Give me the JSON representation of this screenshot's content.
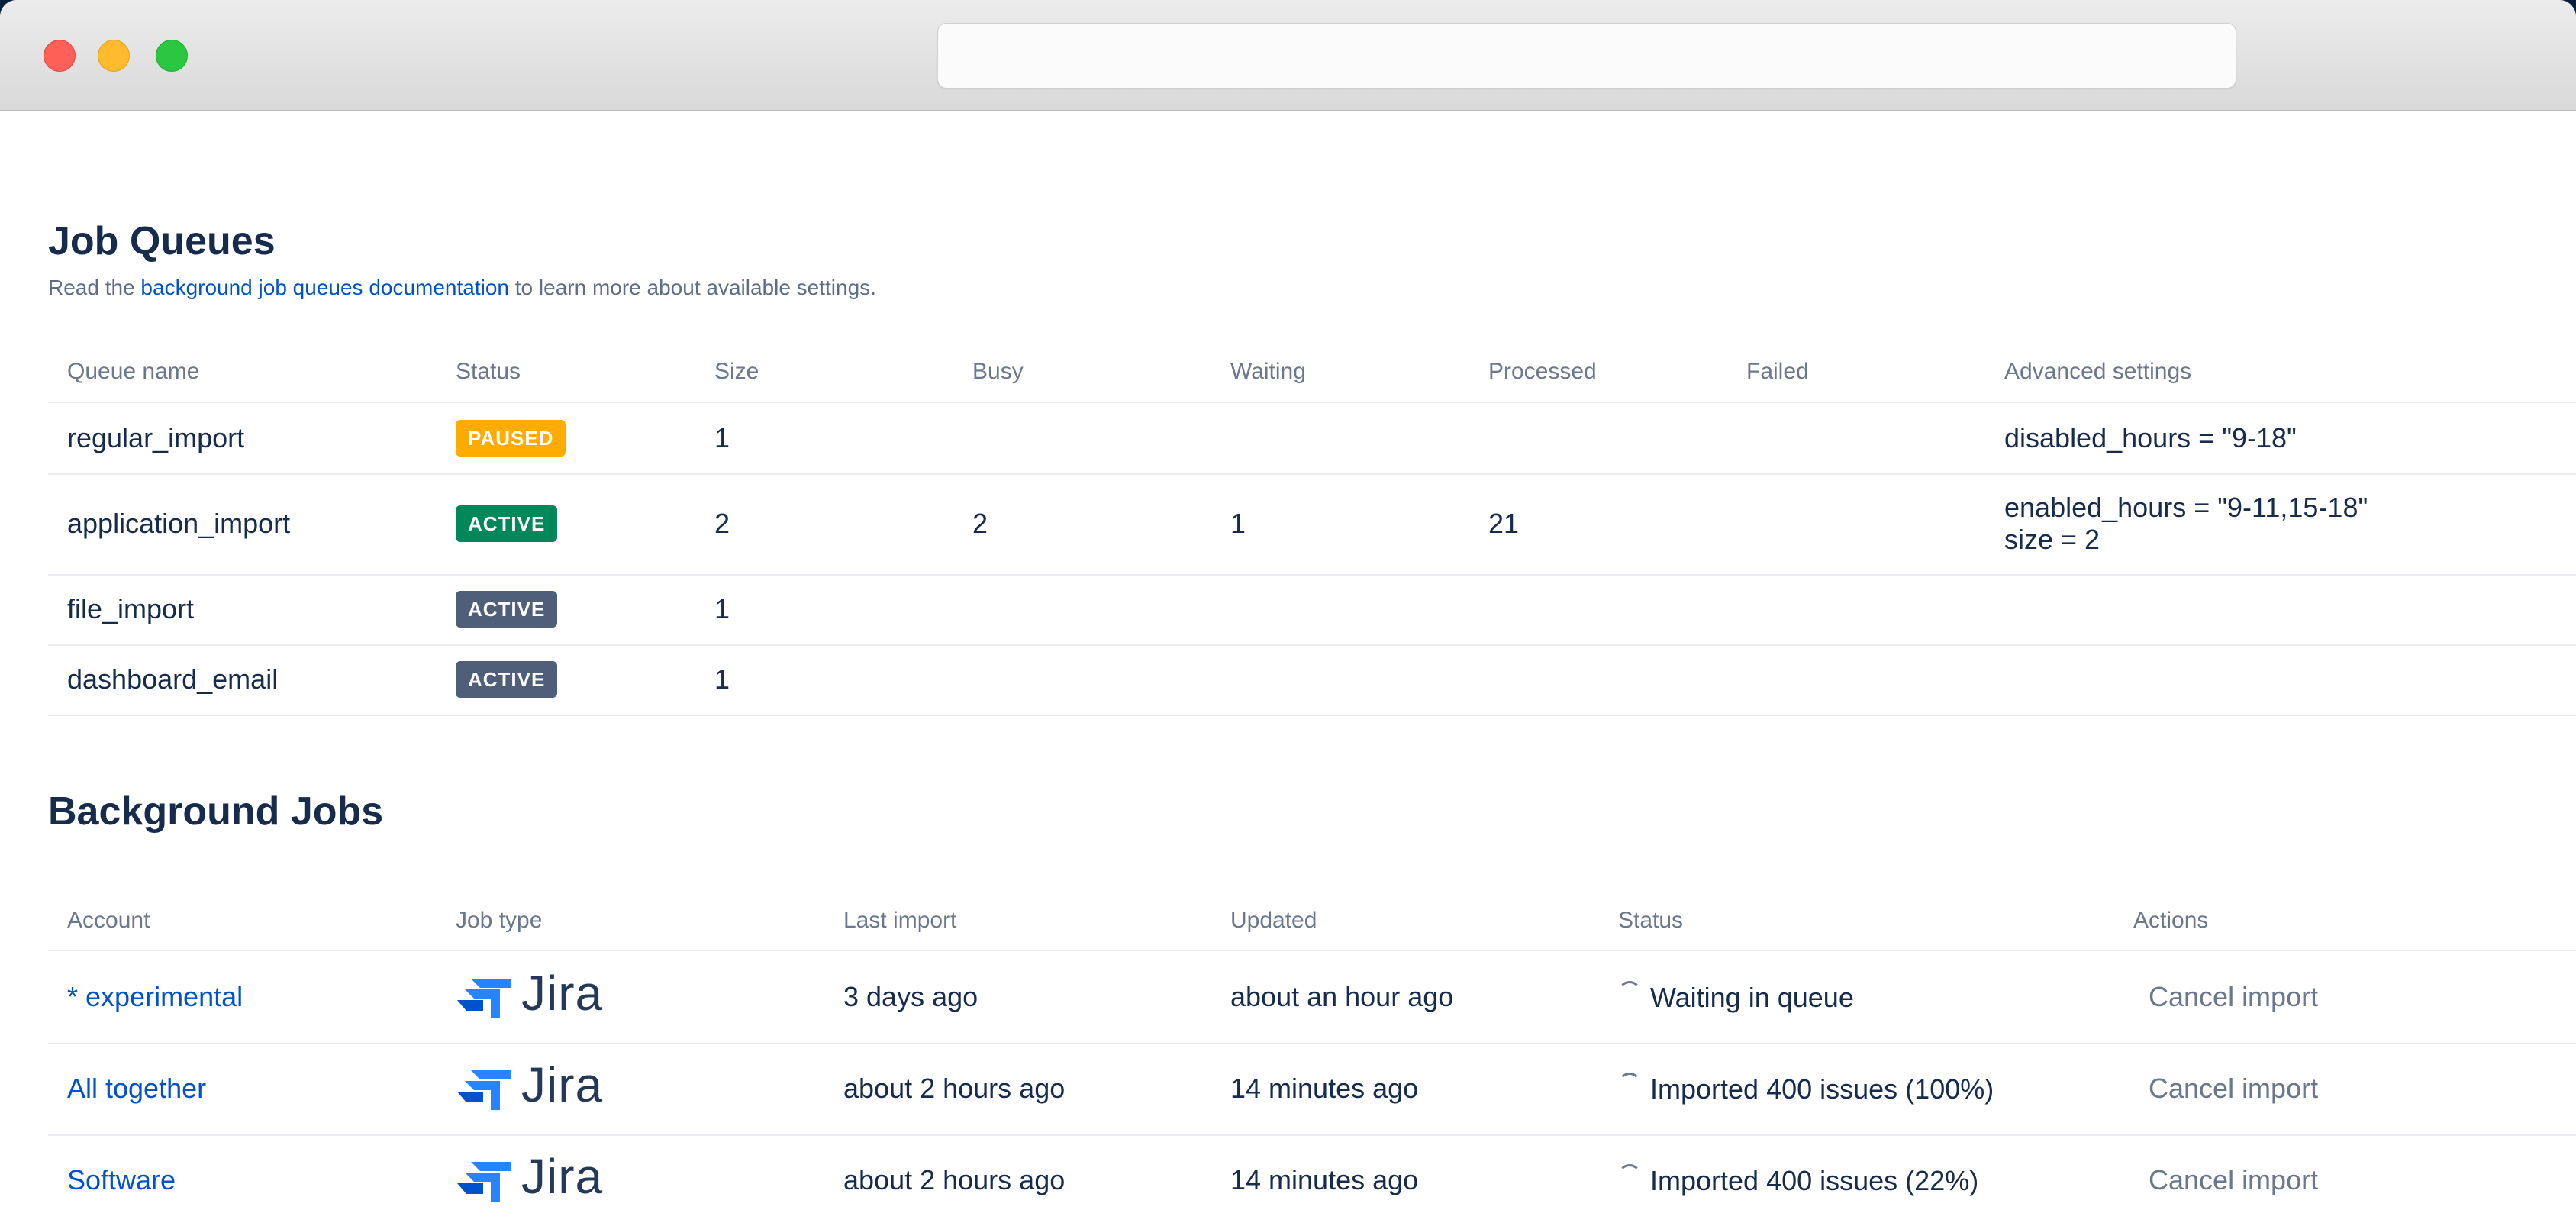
{
  "browser": {
    "url": ""
  },
  "job_queues": {
    "title": "Job Queues",
    "intro_prefix": "Read the ",
    "intro_link": "background job queues documentation",
    "intro_suffix": " to learn more about available settings.",
    "columns": [
      "Queue name",
      "Status",
      "Size",
      "Busy",
      "Waiting",
      "Processed",
      "Failed",
      "Advanced settings"
    ],
    "rows": [
      {
        "name": "regular_import",
        "status": "PAUSED",
        "status_color": "#ffab00",
        "size": "1",
        "busy": "",
        "waiting": "",
        "processed": "",
        "failed": "",
        "settings": [
          "disabled_hours = \"9-18\""
        ]
      },
      {
        "name": "application_import",
        "status": "ACTIVE",
        "status_color": "#00875a",
        "size": "2",
        "busy": "2",
        "waiting": "1",
        "processed": "21",
        "failed": "",
        "settings": [
          "enabled_hours = \"9-11,15-18\"",
          "size = 2"
        ]
      },
      {
        "name": "file_import",
        "status": "ACTIVE",
        "status_color": "#505f79",
        "size": "1",
        "busy": "",
        "waiting": "",
        "processed": "",
        "failed": "",
        "settings": []
      },
      {
        "name": "dashboard_email",
        "status": "ACTIVE",
        "status_color": "#505f79",
        "size": "1",
        "busy": "",
        "waiting": "",
        "processed": "",
        "failed": "",
        "settings": []
      }
    ]
  },
  "background_jobs": {
    "title": "Background Jobs",
    "columns": [
      "Account",
      "Job type",
      "Last import",
      "Updated",
      "Status",
      "Actions"
    ],
    "rows": [
      {
        "account": "* experimental",
        "job_type": "Jira",
        "job_type_icon": "jira-logo-icon",
        "last_import": "3 days ago",
        "updated": "about an hour ago",
        "status": "Waiting in queue",
        "action": "Cancel import"
      },
      {
        "account": "All together",
        "job_type": "Jira",
        "job_type_icon": "jira-logo-icon",
        "last_import": "about 2 hours ago",
        "updated": "14 minutes ago",
        "status": "Imported 400 issues (100%)",
        "action": "Cancel import"
      },
      {
        "account": "Software",
        "job_type": "Jira",
        "job_type_icon": "jira-logo-icon",
        "last_import": "about 2 hours ago",
        "updated": "14 minutes ago",
        "status": "Imported 400 issues (22%)",
        "action": "Cancel import"
      }
    ]
  },
  "colors": {
    "link": "#0052cc",
    "heading": "#172b4d",
    "muted": "#6b778c",
    "paused": "#ffab00",
    "active_green": "#00875a",
    "active_gray": "#505f79"
  }
}
